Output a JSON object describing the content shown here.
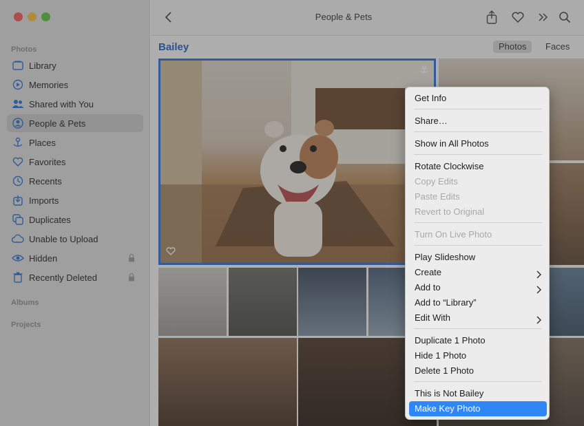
{
  "window": {
    "title": "People & Pets"
  },
  "sidebar": {
    "sections": {
      "photos": "Photos",
      "albums": "Albums",
      "projects": "Projects"
    },
    "items": [
      {
        "label": "Library",
        "icon": "library-icon"
      },
      {
        "label": "Memories",
        "icon": "memories-icon"
      },
      {
        "label": "Shared with You",
        "icon": "shared-icon"
      },
      {
        "label": "People & Pets",
        "icon": "people-icon",
        "selected": true
      },
      {
        "label": "Places",
        "icon": "places-icon"
      },
      {
        "label": "Favorites",
        "icon": "heart-icon"
      },
      {
        "label": "Recents",
        "icon": "clock-icon"
      },
      {
        "label": "Imports",
        "icon": "import-icon"
      },
      {
        "label": "Duplicates",
        "icon": "duplicates-icon"
      },
      {
        "label": "Unable to Upload",
        "icon": "cloud-icon"
      },
      {
        "label": "Hidden",
        "icon": "eye-icon",
        "locked": true
      },
      {
        "label": "Recently Deleted",
        "icon": "trash-icon",
        "locked": true
      }
    ]
  },
  "header": {
    "person": "Bailey",
    "seg_photos": "Photos",
    "seg_faces": "Faces"
  },
  "menu": {
    "items": [
      {
        "label": "Get Info"
      },
      {
        "label": "Share…"
      },
      {
        "label": "Show in All Photos"
      },
      {
        "label": "Rotate Clockwise"
      },
      {
        "label": "Copy Edits",
        "disabled": true
      },
      {
        "label": "Paste Edits",
        "disabled": true
      },
      {
        "label": "Revert to Original",
        "disabled": true
      },
      {
        "label": "Turn On Live Photo",
        "disabled": true
      },
      {
        "label": "Play Slideshow"
      },
      {
        "label": "Create",
        "submenu": true
      },
      {
        "label": "Add to",
        "submenu": true
      },
      {
        "label": "Add to “Library”"
      },
      {
        "label": "Edit With",
        "submenu": true
      },
      {
        "label": "Duplicate 1 Photo"
      },
      {
        "label": "Hide 1 Photo"
      },
      {
        "label": "Delete 1 Photo"
      },
      {
        "label": "This is Not Bailey"
      },
      {
        "label": "Make Key Photo",
        "highlighted": true
      }
    ]
  },
  "colors": {
    "accent": "#2f86f5",
    "person_title": "#1f5fbf",
    "selection_border": "#2a6fd6"
  }
}
